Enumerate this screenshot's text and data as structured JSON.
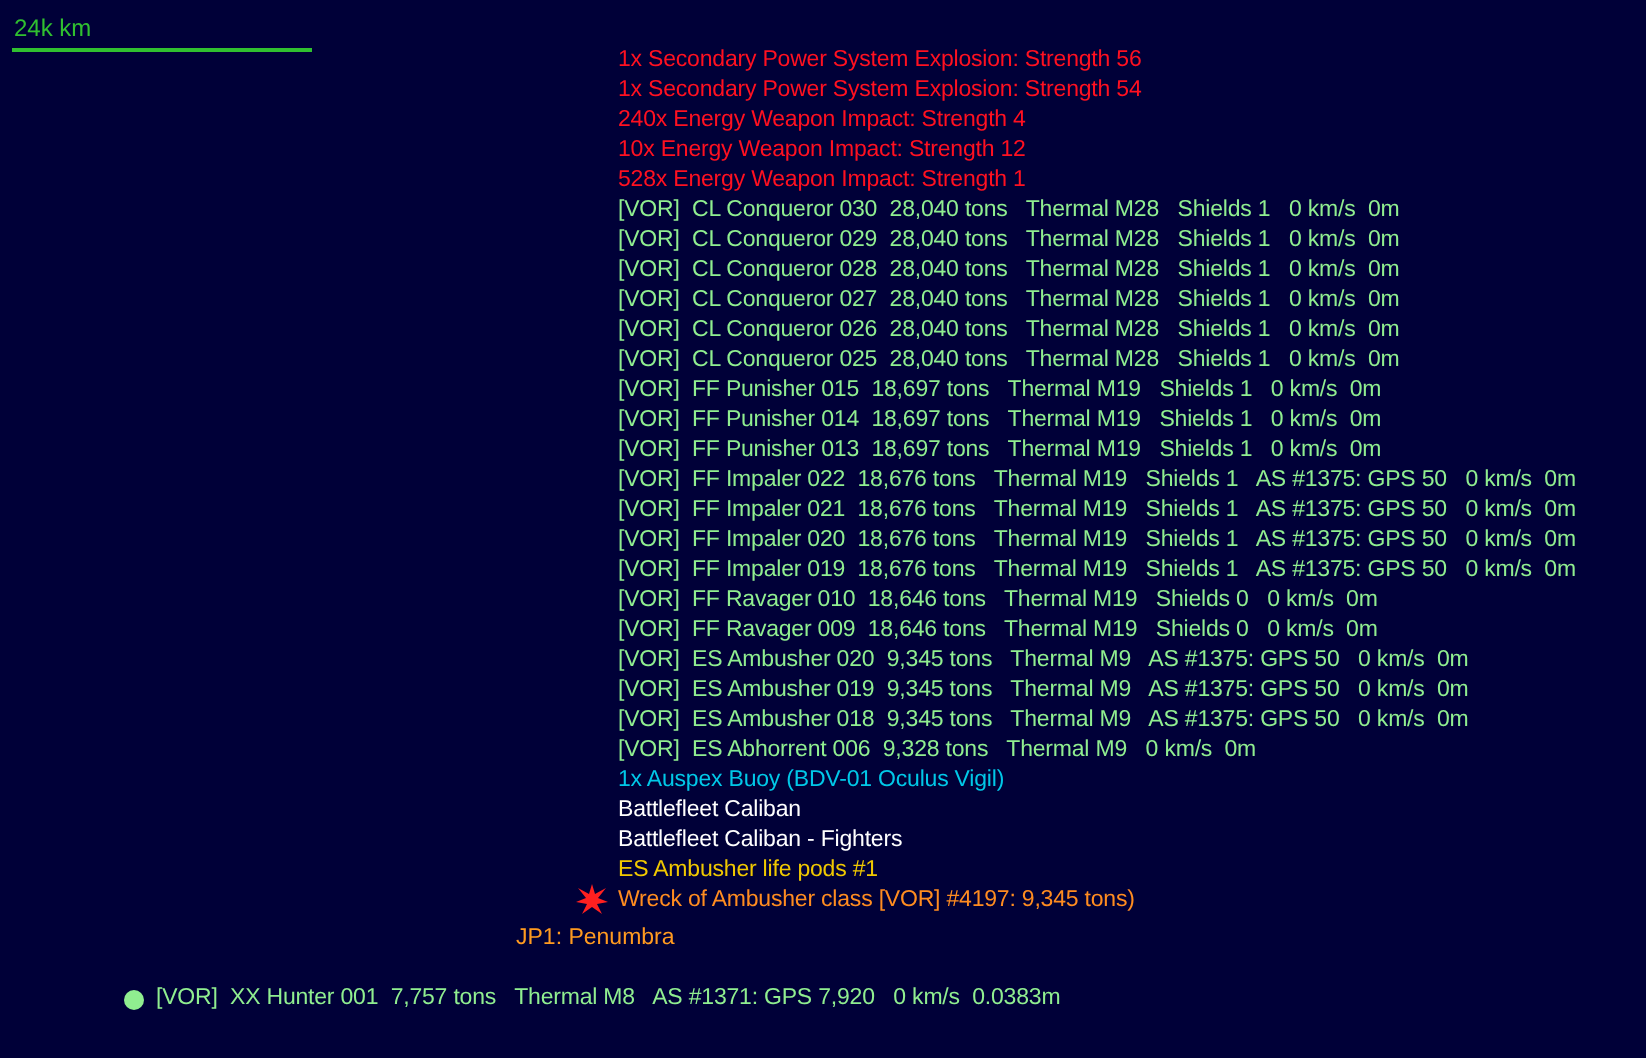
{
  "scale": {
    "label": "24k km"
  },
  "contacts": [
    {
      "kind": "damage",
      "text": "1x Secondary Power System Explosion: Strength 56"
    },
    {
      "kind": "damage",
      "text": "1x Secondary Power System Explosion: Strength 54"
    },
    {
      "kind": "damage",
      "text": "240x Energy Weapon Impact: Strength 4"
    },
    {
      "kind": "damage",
      "text": "10x Energy Weapon Impact: Strength 12"
    },
    {
      "kind": "damage",
      "text": "528x Energy Weapon Impact: Strength 1"
    },
    {
      "kind": "ship",
      "text": "[VOR]  CL Conqueror 030  28,040 tons   Thermal M28   Shields 1   0 km/s  0m"
    },
    {
      "kind": "ship",
      "text": "[VOR]  CL Conqueror 029  28,040 tons   Thermal M28   Shields 1   0 km/s  0m"
    },
    {
      "kind": "ship",
      "text": "[VOR]  CL Conqueror 028  28,040 tons   Thermal M28   Shields 1   0 km/s  0m"
    },
    {
      "kind": "ship",
      "text": "[VOR]  CL Conqueror 027  28,040 tons   Thermal M28   Shields 1   0 km/s  0m"
    },
    {
      "kind": "ship",
      "text": "[VOR]  CL Conqueror 026  28,040 tons   Thermal M28   Shields 1   0 km/s  0m"
    },
    {
      "kind": "ship",
      "text": "[VOR]  CL Conqueror 025  28,040 tons   Thermal M28   Shields 1   0 km/s  0m"
    },
    {
      "kind": "ship",
      "text": "[VOR]  FF Punisher 015  18,697 tons   Thermal M19   Shields 1   0 km/s  0m"
    },
    {
      "kind": "ship",
      "text": "[VOR]  FF Punisher 014  18,697 tons   Thermal M19   Shields 1   0 km/s  0m"
    },
    {
      "kind": "ship",
      "text": "[VOR]  FF Punisher 013  18,697 tons   Thermal M19   Shields 1   0 km/s  0m"
    },
    {
      "kind": "ship",
      "text": "[VOR]  FF Impaler 022  18,676 tons   Thermal M19   Shields 1   AS #1375: GPS 50   0 km/s  0m"
    },
    {
      "kind": "ship",
      "text": "[VOR]  FF Impaler 021  18,676 tons   Thermal M19   Shields 1   AS #1375: GPS 50   0 km/s  0m"
    },
    {
      "kind": "ship",
      "text": "[VOR]  FF Impaler 020  18,676 tons   Thermal M19   Shields 1   AS #1375: GPS 50   0 km/s  0m"
    },
    {
      "kind": "ship",
      "text": "[VOR]  FF Impaler 019  18,676 tons   Thermal M19   Shields 1   AS #1375: GPS 50   0 km/s  0m"
    },
    {
      "kind": "ship",
      "text": "[VOR]  FF Ravager 010  18,646 tons   Thermal M19   Shields 0   0 km/s  0m"
    },
    {
      "kind": "ship",
      "text": "[VOR]  FF Ravager 009  18,646 tons   Thermal M19   Shields 0   0 km/s  0m"
    },
    {
      "kind": "ship",
      "text": "[VOR]  ES Ambusher 020  9,345 tons   Thermal M9   AS #1375: GPS 50   0 km/s  0m"
    },
    {
      "kind": "ship",
      "text": "[VOR]  ES Ambusher 019  9,345 tons   Thermal M9   AS #1375: GPS 50   0 km/s  0m"
    },
    {
      "kind": "ship",
      "text": "[VOR]  ES Ambusher 018  9,345 tons   Thermal M9   AS #1375: GPS 50   0 km/s  0m"
    },
    {
      "kind": "ship",
      "text": "[VOR]  ES Abhorrent 006  9,328 tons   Thermal M9   0 km/s  0m"
    },
    {
      "kind": "buoy",
      "text": "1x Auspex Buoy (BDV-01 Oculus Vigil)"
    },
    {
      "kind": "fleet",
      "text": "Battlefleet Caliban"
    },
    {
      "kind": "fleet",
      "text": "Battlefleet Caliban - Fighters"
    },
    {
      "kind": "lifepod",
      "text": "ES Ambusher life pods #1"
    },
    {
      "kind": "wreck",
      "text": "Wreck of Ambusher class [VOR] #4197: 9,345 tons)"
    }
  ],
  "jump_point": {
    "label": "JP1: Penumbra"
  },
  "own_ship": {
    "text": "[VOR]  XX Hunter 001  7,757 tons   Thermal M8   AS #1371: GPS 7,920   0 km/s  0.0383m"
  }
}
